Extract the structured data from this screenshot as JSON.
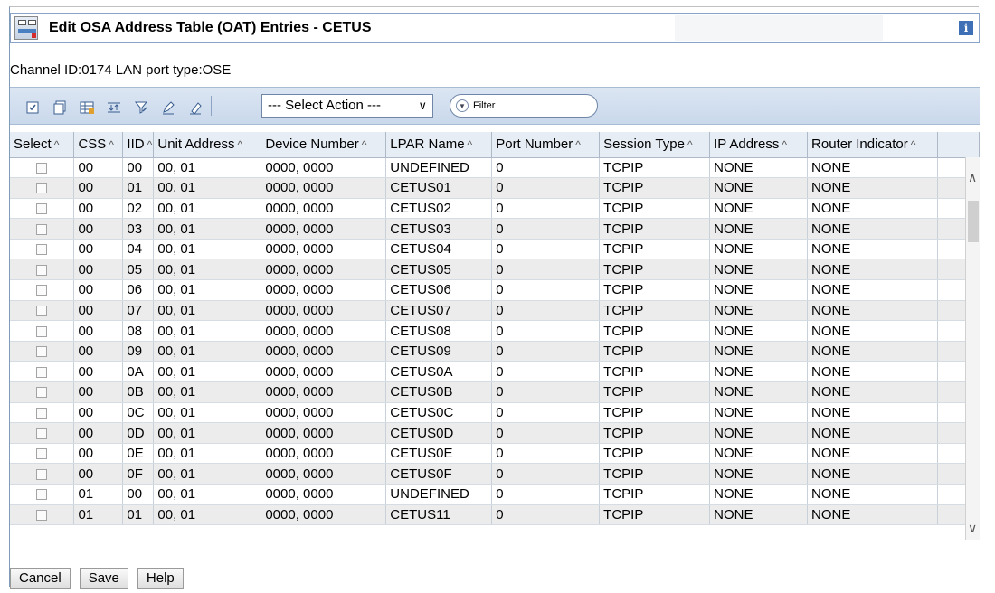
{
  "window": {
    "title": "Edit OSA Address Table (OAT) Entries - CETUS",
    "info_glyph": "i"
  },
  "channel_line": "Channel ID:0174 LAN port type:OSE",
  "toolbar": {
    "icons": [
      "select-all-icon",
      "deselect-all-icon",
      "table-icon",
      "expand-icon",
      "filter-edit-icon",
      "edit-icon",
      "clear-icon"
    ],
    "select_action": "--- Select Action ---",
    "filter_placeholder": "Filter"
  },
  "table": {
    "columns": [
      "Select",
      "CSS",
      "IID",
      "Unit Address",
      "Device Number",
      "LPAR Name",
      "Port Number",
      "Session Type",
      "IP Address",
      "Router Indicator"
    ],
    "sort_glyph": "^",
    "rows": [
      [
        "00",
        "00",
        "00, 01",
        "0000, 0000",
        "UNDEFINED",
        "0",
        "TCPIP",
        "NONE",
        "NONE"
      ],
      [
        "00",
        "01",
        "00, 01",
        "0000, 0000",
        "CETUS01",
        "0",
        "TCPIP",
        "NONE",
        "NONE"
      ],
      [
        "00",
        "02",
        "00, 01",
        "0000, 0000",
        "CETUS02",
        "0",
        "TCPIP",
        "NONE",
        "NONE"
      ],
      [
        "00",
        "03",
        "00, 01",
        "0000, 0000",
        "CETUS03",
        "0",
        "TCPIP",
        "NONE",
        "NONE"
      ],
      [
        "00",
        "04",
        "00, 01",
        "0000, 0000",
        "CETUS04",
        "0",
        "TCPIP",
        "NONE",
        "NONE"
      ],
      [
        "00",
        "05",
        "00, 01",
        "0000, 0000",
        "CETUS05",
        "0",
        "TCPIP",
        "NONE",
        "NONE"
      ],
      [
        "00",
        "06",
        "00, 01",
        "0000, 0000",
        "CETUS06",
        "0",
        "TCPIP",
        "NONE",
        "NONE"
      ],
      [
        "00",
        "07",
        "00, 01",
        "0000, 0000",
        "CETUS07",
        "0",
        "TCPIP",
        "NONE",
        "NONE"
      ],
      [
        "00",
        "08",
        "00, 01",
        "0000, 0000",
        "CETUS08",
        "0",
        "TCPIP",
        "NONE",
        "NONE"
      ],
      [
        "00",
        "09",
        "00, 01",
        "0000, 0000",
        "CETUS09",
        "0",
        "TCPIP",
        "NONE",
        "NONE"
      ],
      [
        "00",
        "0A",
        "00, 01",
        "0000, 0000",
        "CETUS0A",
        "0",
        "TCPIP",
        "NONE",
        "NONE"
      ],
      [
        "00",
        "0B",
        "00, 01",
        "0000, 0000",
        "CETUS0B",
        "0",
        "TCPIP",
        "NONE",
        "NONE"
      ],
      [
        "00",
        "0C",
        "00, 01",
        "0000, 0000",
        "CETUS0C",
        "0",
        "TCPIP",
        "NONE",
        "NONE"
      ],
      [
        "00",
        "0D",
        "00, 01",
        "0000, 0000",
        "CETUS0D",
        "0",
        "TCPIP",
        "NONE",
        "NONE"
      ],
      [
        "00",
        "0E",
        "00, 01",
        "0000, 0000",
        "CETUS0E",
        "0",
        "TCPIP",
        "NONE",
        "NONE"
      ],
      [
        "00",
        "0F",
        "00, 01",
        "0000, 0000",
        "CETUS0F",
        "0",
        "TCPIP",
        "NONE",
        "NONE"
      ],
      [
        "01",
        "00",
        "00, 01",
        "0000, 0000",
        "UNDEFINED",
        "0",
        "TCPIP",
        "NONE",
        "NONE"
      ],
      [
        "01",
        "01",
        "00, 01",
        "0000, 0000",
        "CETUS11",
        "0",
        "TCPIP",
        "NONE",
        "NONE"
      ]
    ]
  },
  "footer": {
    "cancel": "Cancel",
    "save": "Save",
    "help": "Help"
  },
  "colors": {
    "toolbar_bg": "#c9d8eb",
    "header_bg": "#e7edf5",
    "row_alt_bg": "#ececec",
    "info_icon_bg": "#3f6fb5"
  }
}
